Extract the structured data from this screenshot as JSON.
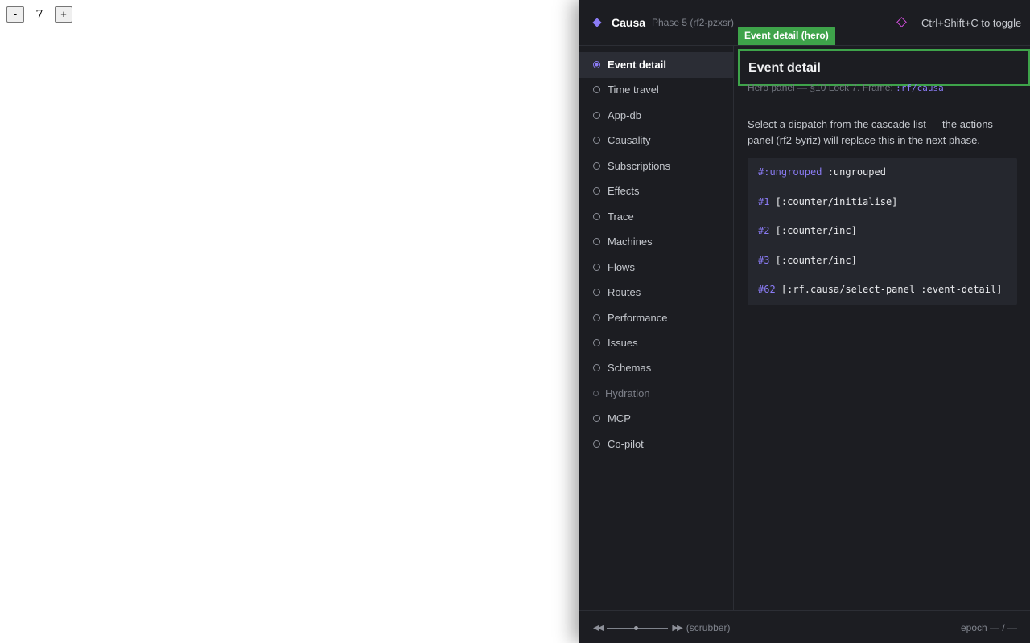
{
  "host": {
    "decrement_label": "-",
    "count": "7",
    "increment_label": "+"
  },
  "header": {
    "app_name": "Causa",
    "phase": "Phase 5 (rf2-pzxsr)",
    "shortcut": "Ctrl+Shift+C to toggle"
  },
  "sidebar": {
    "items": [
      {
        "label": "Event detail",
        "state": "active"
      },
      {
        "label": "Time travel",
        "state": "normal"
      },
      {
        "label": "App-db",
        "state": "normal"
      },
      {
        "label": "Causality",
        "state": "normal"
      },
      {
        "label": "Subscriptions",
        "state": "normal"
      },
      {
        "label": "Effects",
        "state": "normal"
      },
      {
        "label": "Trace",
        "state": "normal"
      },
      {
        "label": "Machines",
        "state": "normal"
      },
      {
        "label": "Flows",
        "state": "normal"
      },
      {
        "label": "Routes",
        "state": "normal"
      },
      {
        "label": "Performance",
        "state": "normal"
      },
      {
        "label": "Issues",
        "state": "normal"
      },
      {
        "label": "Schemas",
        "state": "normal"
      },
      {
        "label": "Hydration",
        "state": "dim"
      },
      {
        "label": "MCP",
        "state": "normal"
      },
      {
        "label": "Co-pilot",
        "state": "normal"
      }
    ]
  },
  "main": {
    "hero_tag": "Event detail (hero)",
    "title": "Event detail",
    "subline_text": "Hero panel — §10 Lock 7. Frame: ",
    "subline_frame": ":rf/causa",
    "description": "Select a dispatch from the cascade list — the actions panel (rf2-5yriz) will replace this in the next phase.",
    "code_lines": [
      {
        "id": "#:ungrouped",
        "text": " :ungrouped"
      },
      {
        "id": "#1",
        "text": " [:counter/initialise]"
      },
      {
        "id": "#2",
        "text": " [:counter/inc]"
      },
      {
        "id": "#3",
        "text": " [:counter/inc]"
      },
      {
        "id": "#62",
        "text": " [:rf.causa/select-panel :event-detail]"
      }
    ]
  },
  "footer": {
    "rewind": "◀◀",
    "forward": "▶▶",
    "scrubber_caption": "(scrubber)",
    "epoch": "epoch — / —"
  },
  "colors": {
    "accent": "#8b7cf6",
    "hero_green": "#3ea34a",
    "panel_bg": "#1c1d22"
  }
}
